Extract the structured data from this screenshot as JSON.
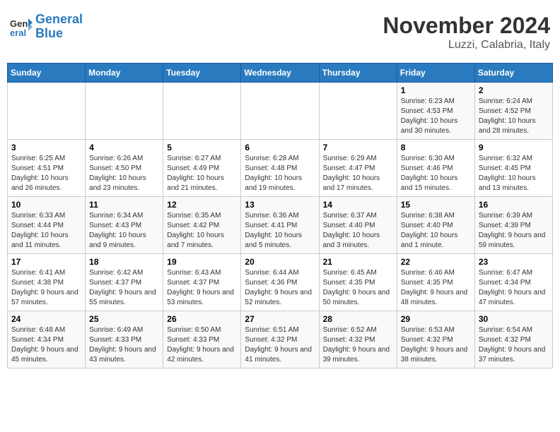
{
  "header": {
    "logo_line1": "General",
    "logo_line2": "Blue",
    "month": "November 2024",
    "location": "Luzzi, Calabria, Italy"
  },
  "days_of_week": [
    "Sunday",
    "Monday",
    "Tuesday",
    "Wednesday",
    "Thursday",
    "Friday",
    "Saturday"
  ],
  "weeks": [
    [
      {
        "day": "",
        "info": ""
      },
      {
        "day": "",
        "info": ""
      },
      {
        "day": "",
        "info": ""
      },
      {
        "day": "",
        "info": ""
      },
      {
        "day": "",
        "info": ""
      },
      {
        "day": "1",
        "info": "Sunrise: 6:23 AM\nSunset: 4:53 PM\nDaylight: 10 hours and 30 minutes."
      },
      {
        "day": "2",
        "info": "Sunrise: 6:24 AM\nSunset: 4:52 PM\nDaylight: 10 hours and 28 minutes."
      }
    ],
    [
      {
        "day": "3",
        "info": "Sunrise: 6:25 AM\nSunset: 4:51 PM\nDaylight: 10 hours and 26 minutes."
      },
      {
        "day": "4",
        "info": "Sunrise: 6:26 AM\nSunset: 4:50 PM\nDaylight: 10 hours and 23 minutes."
      },
      {
        "day": "5",
        "info": "Sunrise: 6:27 AM\nSunset: 4:49 PM\nDaylight: 10 hours and 21 minutes."
      },
      {
        "day": "6",
        "info": "Sunrise: 6:28 AM\nSunset: 4:48 PM\nDaylight: 10 hours and 19 minutes."
      },
      {
        "day": "7",
        "info": "Sunrise: 6:29 AM\nSunset: 4:47 PM\nDaylight: 10 hours and 17 minutes."
      },
      {
        "day": "8",
        "info": "Sunrise: 6:30 AM\nSunset: 4:46 PM\nDaylight: 10 hours and 15 minutes."
      },
      {
        "day": "9",
        "info": "Sunrise: 6:32 AM\nSunset: 4:45 PM\nDaylight: 10 hours and 13 minutes."
      }
    ],
    [
      {
        "day": "10",
        "info": "Sunrise: 6:33 AM\nSunset: 4:44 PM\nDaylight: 10 hours and 11 minutes."
      },
      {
        "day": "11",
        "info": "Sunrise: 6:34 AM\nSunset: 4:43 PM\nDaylight: 10 hours and 9 minutes."
      },
      {
        "day": "12",
        "info": "Sunrise: 6:35 AM\nSunset: 4:42 PM\nDaylight: 10 hours and 7 minutes."
      },
      {
        "day": "13",
        "info": "Sunrise: 6:36 AM\nSunset: 4:41 PM\nDaylight: 10 hours and 5 minutes."
      },
      {
        "day": "14",
        "info": "Sunrise: 6:37 AM\nSunset: 4:40 PM\nDaylight: 10 hours and 3 minutes."
      },
      {
        "day": "15",
        "info": "Sunrise: 6:38 AM\nSunset: 4:40 PM\nDaylight: 10 hours and 1 minute."
      },
      {
        "day": "16",
        "info": "Sunrise: 6:39 AM\nSunset: 4:39 PM\nDaylight: 9 hours and 59 minutes."
      }
    ],
    [
      {
        "day": "17",
        "info": "Sunrise: 6:41 AM\nSunset: 4:38 PM\nDaylight: 9 hours and 57 minutes."
      },
      {
        "day": "18",
        "info": "Sunrise: 6:42 AM\nSunset: 4:37 PM\nDaylight: 9 hours and 55 minutes."
      },
      {
        "day": "19",
        "info": "Sunrise: 6:43 AM\nSunset: 4:37 PM\nDaylight: 9 hours and 53 minutes."
      },
      {
        "day": "20",
        "info": "Sunrise: 6:44 AM\nSunset: 4:36 PM\nDaylight: 9 hours and 52 minutes."
      },
      {
        "day": "21",
        "info": "Sunrise: 6:45 AM\nSunset: 4:35 PM\nDaylight: 9 hours and 50 minutes."
      },
      {
        "day": "22",
        "info": "Sunrise: 6:46 AM\nSunset: 4:35 PM\nDaylight: 9 hours and 48 minutes."
      },
      {
        "day": "23",
        "info": "Sunrise: 6:47 AM\nSunset: 4:34 PM\nDaylight: 9 hours and 47 minutes."
      }
    ],
    [
      {
        "day": "24",
        "info": "Sunrise: 6:48 AM\nSunset: 4:34 PM\nDaylight: 9 hours and 45 minutes."
      },
      {
        "day": "25",
        "info": "Sunrise: 6:49 AM\nSunset: 4:33 PM\nDaylight: 9 hours and 43 minutes."
      },
      {
        "day": "26",
        "info": "Sunrise: 6:50 AM\nSunset: 4:33 PM\nDaylight: 9 hours and 42 minutes."
      },
      {
        "day": "27",
        "info": "Sunrise: 6:51 AM\nSunset: 4:32 PM\nDaylight: 9 hours and 41 minutes."
      },
      {
        "day": "28",
        "info": "Sunrise: 6:52 AM\nSunset: 4:32 PM\nDaylight: 9 hours and 39 minutes."
      },
      {
        "day": "29",
        "info": "Sunrise: 6:53 AM\nSunset: 4:32 PM\nDaylight: 9 hours and 38 minutes."
      },
      {
        "day": "30",
        "info": "Sunrise: 6:54 AM\nSunset: 4:32 PM\nDaylight: 9 hours and 37 minutes."
      }
    ]
  ]
}
